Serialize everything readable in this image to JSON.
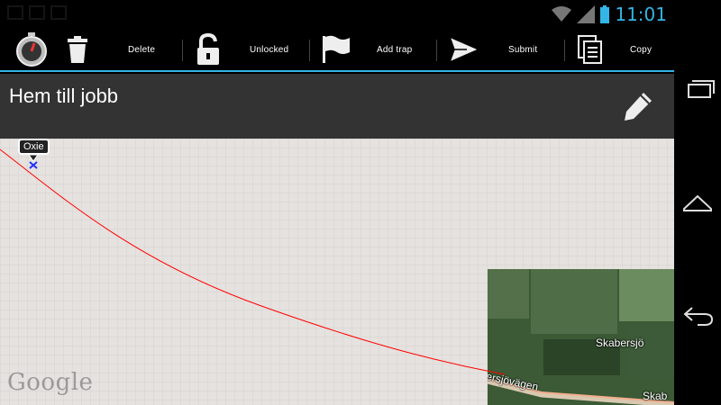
{
  "status": {
    "time": "11:01"
  },
  "toolbar": {
    "delete_label": "Delete",
    "lock_label": "Unlocked",
    "trap_label": "Add trap",
    "submit_label": "Submit",
    "copy_label": "Copy"
  },
  "title": "Hem till jobb",
  "map": {
    "marker_label": "Oxie",
    "place_label": "Skabersjö",
    "road_label_left": "ersjövägen",
    "road_label_right": "Skab",
    "logo": "Google"
  },
  "colors": {
    "accent": "#33b5e5",
    "route": "#ff0000",
    "map_bg": "#e5e2df",
    "title_bar": "#333333"
  },
  "icons": {
    "app": "stopwatch-icon",
    "delete": "trash-icon",
    "lock": "unlock-icon",
    "trap": "flag-icon",
    "submit": "send-icon",
    "copy": "copy-icon",
    "edit": "pencil-icon"
  }
}
